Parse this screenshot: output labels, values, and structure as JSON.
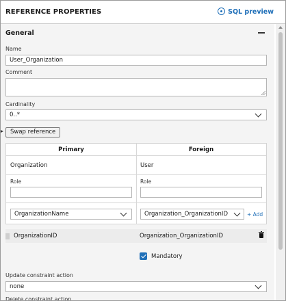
{
  "header": {
    "title": "REFERENCE PROPERTIES",
    "sql_preview_label": "SQL preview",
    "sql_preview_icon": "eye-icon",
    "accent_color": "#1f6fb8"
  },
  "general": {
    "section_title": "General",
    "name_label": "Name",
    "name_value": "User_Organization",
    "comment_label": "Comment",
    "comment_value": "",
    "cardinality_label": "Cardinality",
    "cardinality_value": "0..*",
    "swap_button_label": "Swap reference"
  },
  "reference_table": {
    "primary_header": "Primary",
    "foreign_header": "Foreign",
    "primary_entity": "Organization",
    "foreign_entity": "User",
    "primary_role_label": "Role",
    "primary_role_value": "",
    "foreign_role_label": "Role",
    "foreign_role_value": "",
    "primary_attribute_select": "OrganizationName",
    "foreign_attribute_select": "Organization_OrganizationID",
    "add_label": "+ Add"
  },
  "mapping": {
    "primary_column": "OrganizationID",
    "foreign_column": "Organization_OrganizationID",
    "delete_icon": "trash-icon"
  },
  "mandatory": {
    "label": "Mandatory",
    "checked": true
  },
  "constraints": {
    "update_label": "Update constraint action",
    "update_value": "none",
    "delete_label": "Delete constraint action"
  }
}
